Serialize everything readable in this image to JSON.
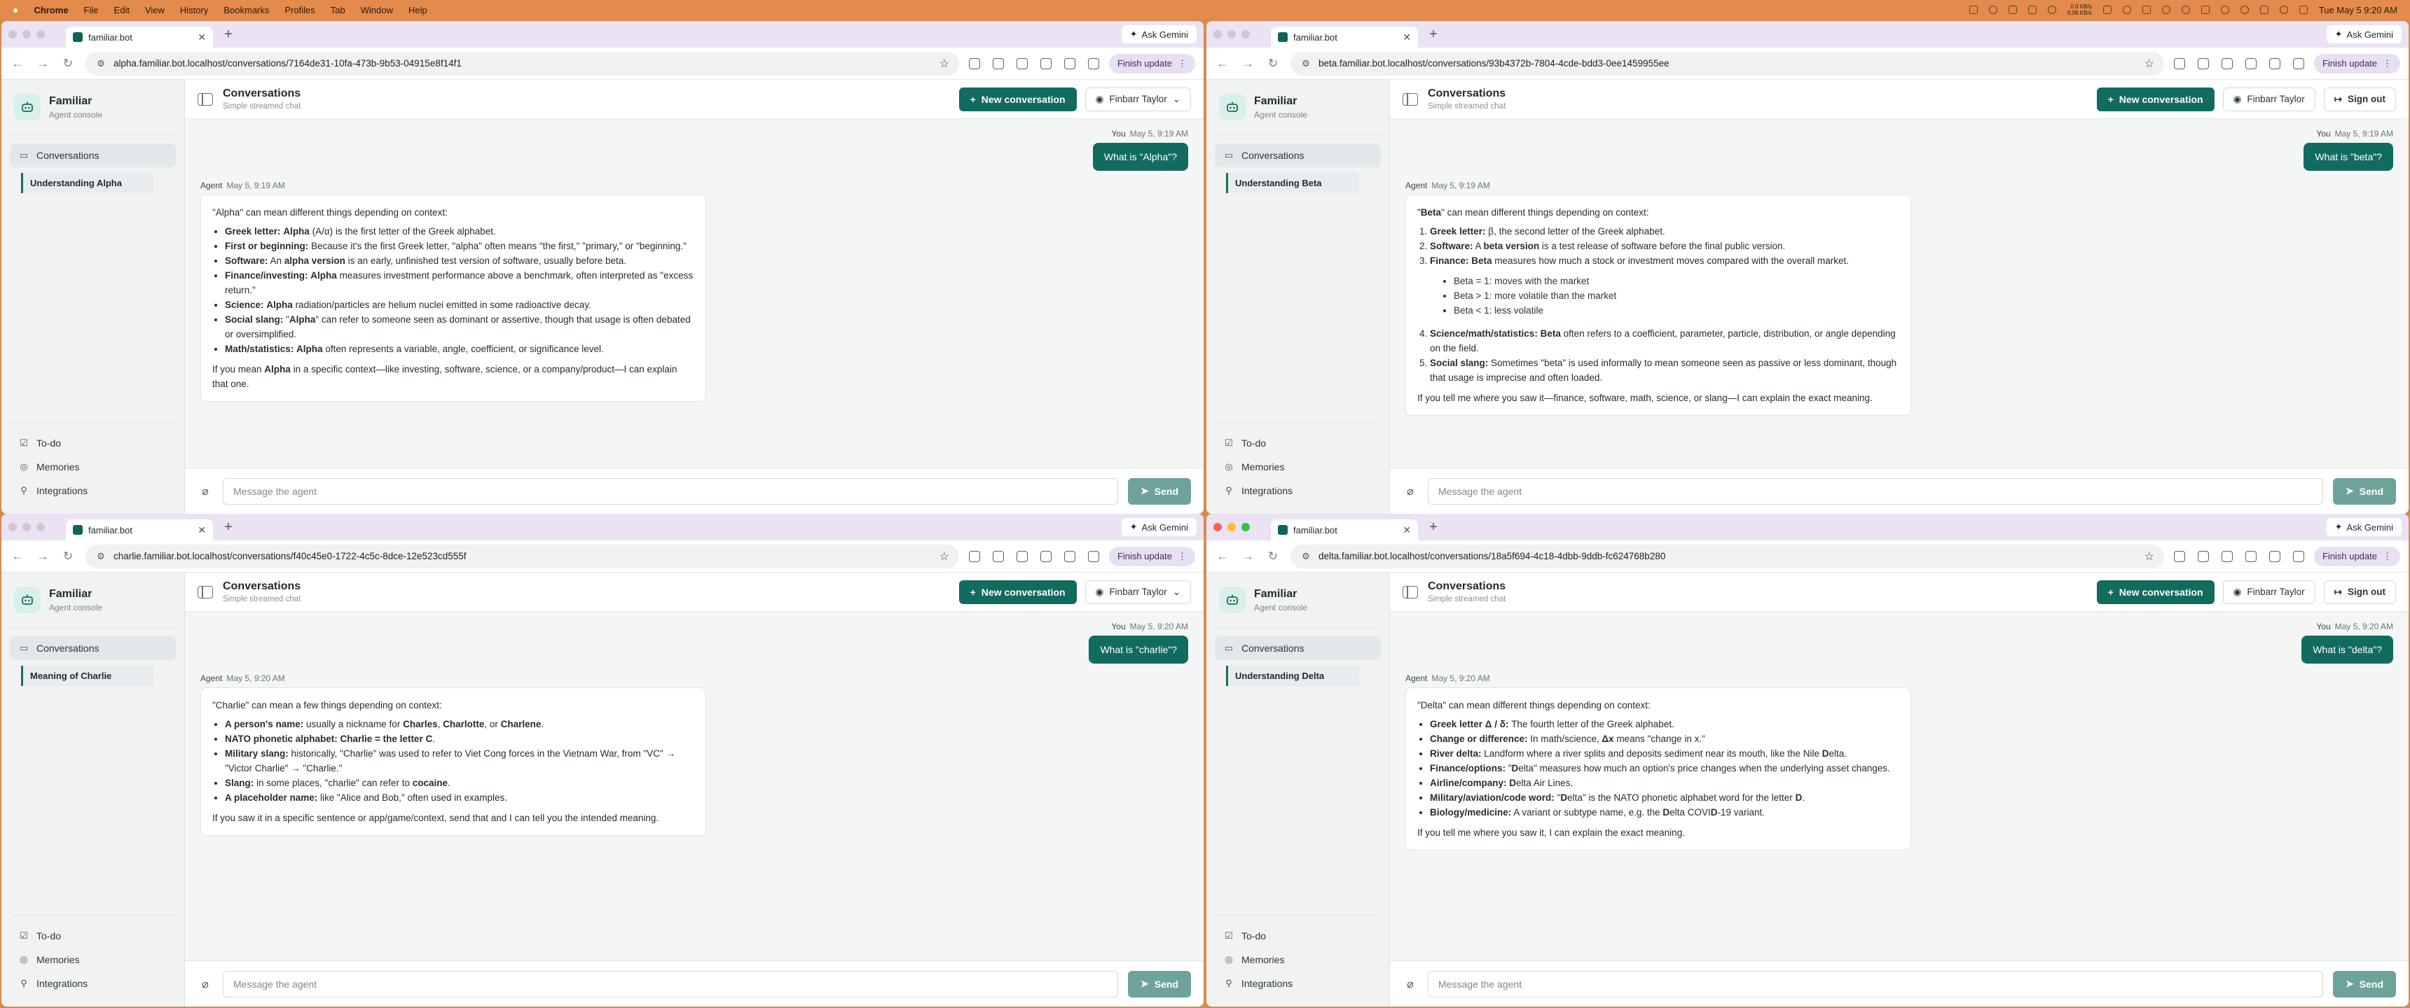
{
  "menubar": {
    "app": "Chrome",
    "items": [
      "File",
      "Edit",
      "View",
      "History",
      "Bookmarks",
      "Profiles",
      "Tab",
      "Window",
      "Help"
    ],
    "net_up": "0.0 KB/s",
    "net_down": "0.06 KB/s",
    "clock": "Tue May 5 9:20 AM"
  },
  "common": {
    "ask_gemini": "Ask Gemini",
    "finish_update": "Finish update",
    "brand_name": "Familiar",
    "brand_sub": "Agent console",
    "nav_conversations": "Conversations",
    "nav_todo": "To-do",
    "nav_memories": "Memories",
    "nav_integrations": "Integrations",
    "header_title": "Conversations",
    "header_sub": "Simple streamed chat",
    "new_conversation": "New conversation",
    "user_name": "Finbarr Taylor",
    "sign_out": "Sign out",
    "composer_placeholder": "Message the agent",
    "send": "Send",
    "you": "You",
    "agent": "Agent",
    "tab_title": "familiar.bot"
  },
  "windows": [
    {
      "url": "alpha.familiar.bot.localhost/conversations/7164de31-10fa-473b-9b53-04915e8f14f1",
      "conversation": "Understanding Alpha",
      "user_time": "May 5, 9:19 AM",
      "user_msg": "What is \"Alpha\"?",
      "agent_time": "May 5, 9:19 AM",
      "intro": "\"Alpha\" can mean different things depending on context:",
      "items": [
        [
          "Greek letter:",
          " Alpha (Α/α) is the first letter of the Greek alphabet."
        ],
        [
          "First or beginning:",
          " Because it's the first Greek letter, \"alpha\" often means \"the first,\" \"primary,\" or \"beginning.\""
        ],
        [
          "Software:",
          " An alpha version is an early, unfinished test version of software, usually before beta."
        ],
        [
          "Finance/investing:",
          " Alpha measures investment performance above a benchmark, often interpreted as \"excess return.\""
        ],
        [
          "Science:",
          " Alpha radiation/particles are helium nuclei emitted in some radioactive decay."
        ],
        [
          "Social slang:",
          " \"Alpha\" can refer to someone seen as dominant or assertive, though that usage is often debated or oversimplified."
        ],
        [
          "Math/statistics:",
          " Alpha often represents a variable, angle, coefficient, or significance level."
        ]
      ],
      "outro": "If you mean Alpha in a specific context—like investing, software, science, or a company/product—I can explain that one."
    },
    {
      "url": "beta.familiar.bot.localhost/conversations/93b4372b-7804-4cde-bdd3-0ee1459955ee",
      "conversation": "Understanding Beta",
      "user_time": "May 5, 9:19 AM",
      "user_msg": "What is \"beta\"?",
      "agent_time": "May 5, 9:19 AM",
      "intro": "\"Beta\" can mean different things depending on context:",
      "items": [
        [
          "Greek letter:",
          " β, the second letter of the Greek alphabet."
        ],
        [
          "Software:",
          " A beta version is a test release of software before the final public version."
        ],
        [
          "Finance:",
          " Beta measures how much a stock or investment moves compared with the overall market."
        ],
        [
          "Science/math/statistics:",
          " Beta often refers to a coefficient, parameter, particle, distribution, or angle depending on the field."
        ],
        [
          "Social slang:",
          " Sometimes \"beta\" is used informally to mean someone seen as passive or less dominant, though that usage is imprecise and often loaded."
        ]
      ],
      "subitems": [
        "Beta = 1: moves with the market",
        "Beta > 1: more volatile than the market",
        "Beta < 1: less volatile"
      ],
      "outro": "If you tell me where you saw it—finance, software, math, science, or slang—I can explain the exact meaning."
    },
    {
      "url": "charlie.familiar.bot.localhost/conversations/f40c45e0-1722-4c5c-8dce-12e523cd555f",
      "conversation": "Meaning of Charlie",
      "user_time": "May 5, 9:20 AM",
      "user_msg": "What is \"charlie\"?",
      "agent_time": "May 5, 9:20 AM",
      "intro": "\"Charlie\" can mean a few things depending on context:",
      "items": [
        [
          "A person's name:",
          " usually a nickname for Charles, Charlotte, or Charlene."
        ],
        [
          "NATO phonetic alphabet:",
          " Charlie = the letter C."
        ],
        [
          "Military slang:",
          " historically, \"Charlie\" was used to refer to Viet Cong forces in the Vietnam War, from \"VC\" → \"Victor Charlie\" → \"Charlie.\""
        ],
        [
          "Slang:",
          " in some places, \"charlie\" can refer to cocaine."
        ],
        [
          "A placeholder name:",
          " like \"Alice and Bob,\" often used in examples."
        ]
      ],
      "outro": "If you saw it in a specific sentence or app/game/context, send that and I can tell you the intended meaning."
    },
    {
      "url": "delta.familiar.bot.localhost/conversations/18a5f694-4c18-4dbb-9ddb-fc624768b280",
      "conversation": "Understanding Delta",
      "user_time": "May 5, 9:20 AM",
      "user_msg": "What is \"delta\"?",
      "agent_time": "May 5, 9:20 AM",
      "intro": "\"Delta\" can mean different things depending on context:",
      "items": [
        [
          "Greek letter Δ / δ:",
          " The fourth letter of the Greek alphabet."
        ],
        [
          "Change or difference:",
          " In math/science, Δx means \"change in x.\""
        ],
        [
          "River delta:",
          " Landform where a river splits and deposits sediment near its mouth, like the Nile Delta."
        ],
        [
          "Finance/options:",
          " \"Delta\" measures how much an option's price changes when the underlying asset changes."
        ],
        [
          "Airline/company:",
          " Delta Air Lines."
        ],
        [
          "Military/aviation/code word:",
          " \"Delta\" is the NATO phonetic alphabet word for the letter D."
        ],
        [
          "Biology/medicine:",
          " A variant or subtype name, e.g. the Delta COVID-19 variant."
        ]
      ],
      "outro": "If you tell me where you saw it, I can explain the exact meaning."
    }
  ]
}
